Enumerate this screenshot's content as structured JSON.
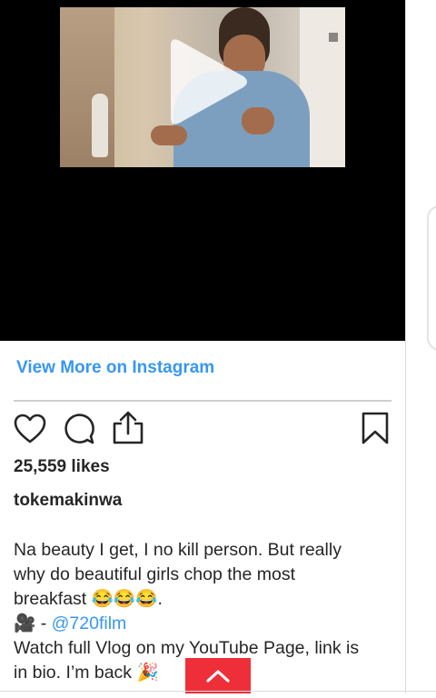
{
  "embed": {
    "view_more_label": "View More on Instagram",
    "likes_text": "25,559 likes",
    "username": "tokemakinwa",
    "caption": {
      "line1": "Na beauty I get, I no kill person. But really",
      "line2": "why do beautiful girls chop the most",
      "line3": "breakfast 😂😂😂.",
      "line4_prefix": "🎥 - ",
      "line4_mention": "@720film",
      "line5": "Watch full Vlog on my YouTube Page, link is",
      "line6": "in bio. I’m back 🎉"
    }
  },
  "icons": {
    "play": "play-icon",
    "heart": "heart-icon",
    "comment": "comment-icon",
    "share": "share-icon",
    "bookmark": "bookmark-icon",
    "scroll_top": "chevron-up-icon"
  },
  "colors": {
    "link_blue": "#3897f0",
    "scroll_button_red": "#ee2f3a",
    "video_bg": "#000000"
  }
}
